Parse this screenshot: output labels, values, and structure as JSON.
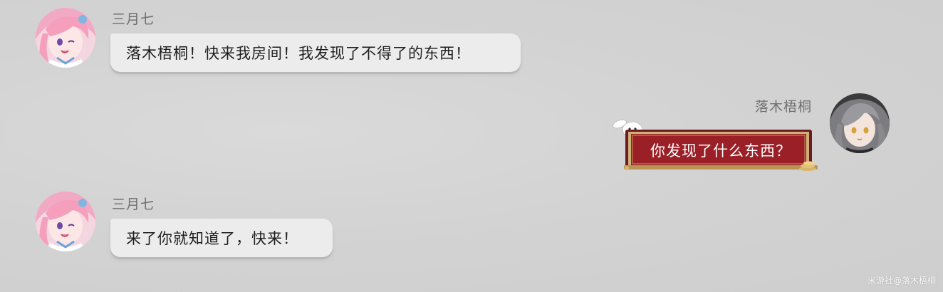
{
  "messages": [
    {
      "sender": "三月七",
      "text": "落木梧桐！快来我房间！我发现了不得了的东西！",
      "avatar_icon": "march7-avatar"
    },
    {
      "sender": "落木梧桐",
      "text": "你发现了什么东西？",
      "avatar_icon": "stelle-avatar"
    },
    {
      "sender": "三月七",
      "text": "来了你就知道了，快来！",
      "avatar_icon": "march7-avatar"
    }
  ],
  "watermark": "米游社@落木梧桐",
  "colors": {
    "background": "#d3d3d3",
    "bubble": "#ececec",
    "fancy_bubble": "#9a1f26",
    "fancy_frame": "#c9a86a",
    "name_text": "#6f6f6f"
  }
}
